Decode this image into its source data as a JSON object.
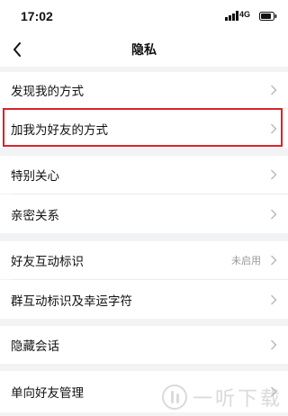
{
  "status_bar": {
    "time": "17:02",
    "network": "4G",
    "signal_icon": "signal-bars-icon",
    "battery_icon": "battery-icon"
  },
  "nav": {
    "title": "隐私",
    "back_icon": "back-arrow-icon"
  },
  "settings": {
    "group1": [
      {
        "label": "发现我的方式"
      },
      {
        "label": "加我为好友的方式",
        "highlighted": true
      }
    ],
    "group2": [
      {
        "label": "特别关心"
      },
      {
        "label": "亲密关系"
      }
    ],
    "group3": [
      {
        "label": "好友互动标识",
        "value": "未启用"
      },
      {
        "label": "群互动标识及幸运字符"
      }
    ],
    "group4": [
      {
        "label": "隐藏会话"
      }
    ],
    "group5": [
      {
        "label": "单向好友管理"
      }
    ]
  },
  "watermark": {
    "text": "一听下载"
  },
  "colors": {
    "highlight": "#d9232d",
    "background": "#f2f3f5",
    "row": "#ffffff",
    "secondary_text": "#9a9a9a"
  }
}
